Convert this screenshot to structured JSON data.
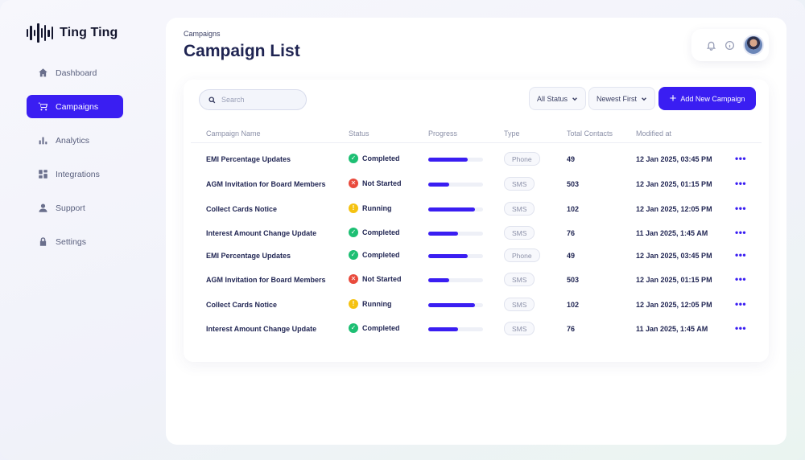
{
  "app": {
    "name": "Ting Ting"
  },
  "sidebar": {
    "items": [
      {
        "label": "Dashboard",
        "icon": "home-icon",
        "active": false
      },
      {
        "label": "Campaigns",
        "icon": "cart-icon",
        "active": true
      },
      {
        "label": "Analytics",
        "icon": "bar-chart-icon",
        "active": false
      },
      {
        "label": "Integrations",
        "icon": "grid-icon",
        "active": false
      },
      {
        "label": "Support",
        "icon": "user-icon",
        "active": false
      },
      {
        "label": "Settings",
        "icon": "lock-icon",
        "active": false
      }
    ]
  },
  "header": {
    "breadcrumb": "Campaigns",
    "title": "Campaign List"
  },
  "toolbar": {
    "search_placeholder": "Search",
    "status_filter": "All Status",
    "sort": "Newest First",
    "add_label": "Add New Campaign"
  },
  "table": {
    "columns": [
      "Campaign Name",
      "Status",
      "Progress",
      "Type",
      "Total Contacts",
      "Modified at"
    ],
    "rows": [
      {
        "name": "EMI Percentage Updates",
        "status": "Completed",
        "status_kind": "done",
        "progress": 0.72,
        "type": "Phone",
        "contacts": "49",
        "modified": "12 Jan 2025, 03:45 PM"
      },
      {
        "name": "AGM Invitation for Board Members",
        "status": "Not Started",
        "status_kind": "err",
        "progress": 0.38,
        "type": "SMS",
        "contacts": "503",
        "modified": "12 Jan 2025, 01:15 PM"
      },
      {
        "name": "Collect Cards Notice",
        "status": "Running",
        "status_kind": "run",
        "progress": 0.85,
        "type": "SMS",
        "contacts": "102",
        "modified": "12 Jan 2025, 12:05 PM"
      },
      {
        "name": "Interest Amount Change Update",
        "status": "Completed",
        "status_kind": "done",
        "progress": 0.55,
        "type": "SMS",
        "contacts": "76",
        "modified": "11 Jan 2025, 1:45 AM"
      },
      {
        "name": "EMI Percentage Updates",
        "status": "Completed",
        "status_kind": "done",
        "progress": 0.72,
        "type": "Phone",
        "contacts": "49",
        "modified": "12 Jan 2025, 03:45 PM"
      },
      {
        "name": "AGM Invitation for Board Members",
        "status": "Not Started",
        "status_kind": "err",
        "progress": 0.38,
        "type": "SMS",
        "contacts": "503",
        "modified": "12 Jan 2025, 01:15 PM"
      },
      {
        "name": "Collect Cards Notice",
        "status": "Running",
        "status_kind": "run",
        "progress": 0.85,
        "type": "SMS",
        "contacts": "102",
        "modified": "12 Jan 2025, 12:05 PM"
      },
      {
        "name": "Interest Amount Change Update",
        "status": "Completed",
        "status_kind": "done",
        "progress": 0.55,
        "type": "SMS",
        "contacts": "76",
        "modified": "11 Jan 2025, 1:45 AM"
      }
    ]
  },
  "colors": {
    "accent": "#3a1ef2",
    "completed": "#1dbf73",
    "not_started": "#e94a3c",
    "running": "#f5c211"
  }
}
